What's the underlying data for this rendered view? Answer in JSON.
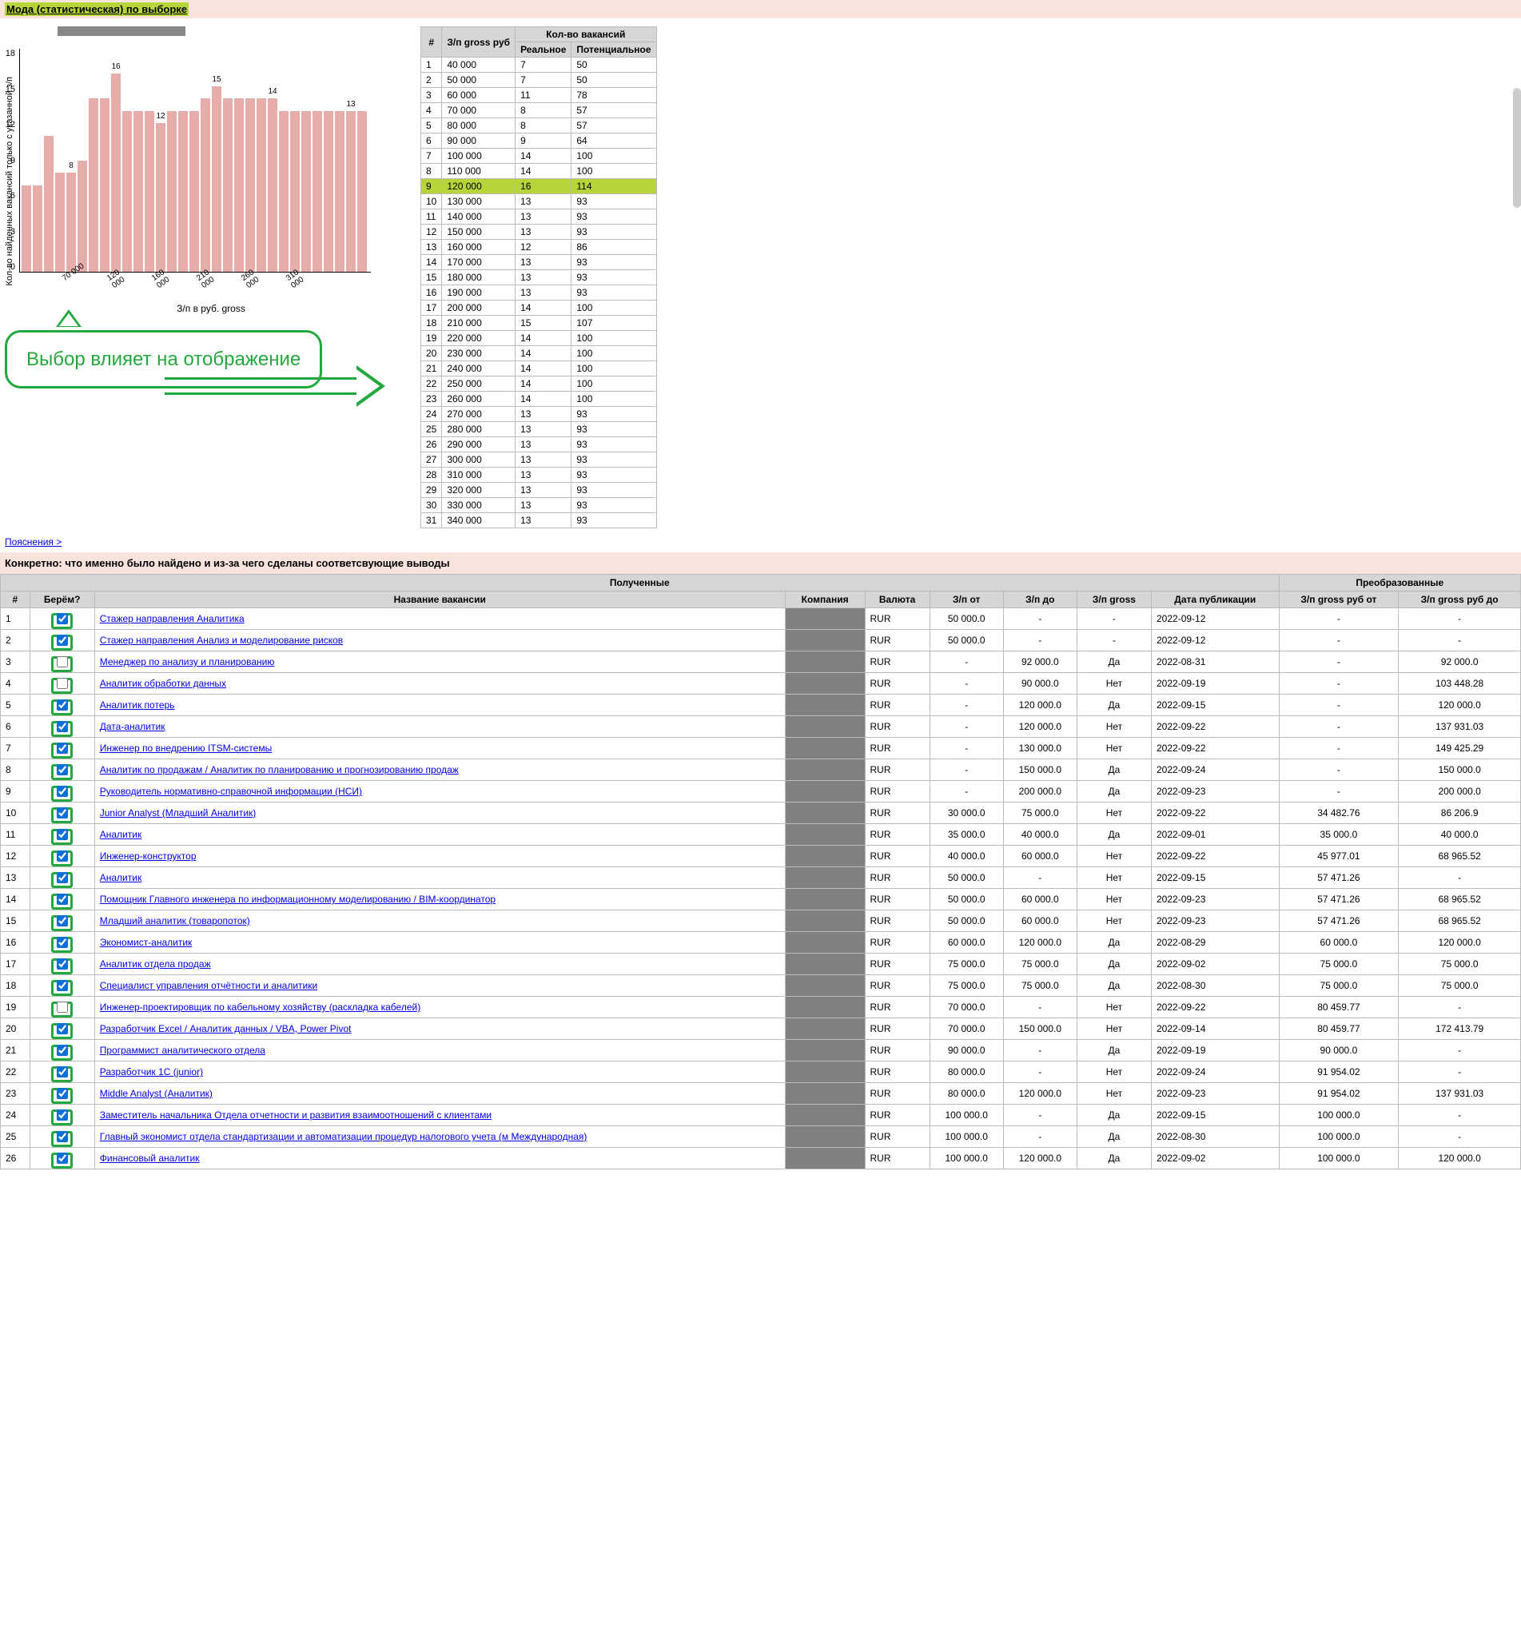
{
  "header": {
    "title": "Мода (статистическая) по выборке"
  },
  "chart_data": {
    "type": "bar",
    "xlabel": "З/п в руб. gross",
    "ylabel": "Кол-во найденных вакансий\nтолько с указанной з/п",
    "ylim": [
      0,
      18
    ],
    "yticks": [
      0,
      3,
      6,
      9,
      12,
      15,
      18
    ],
    "xticks": [
      "70 000",
      "120 000",
      "160 000",
      "210 000",
      "260 000",
      "310 000"
    ],
    "values": [
      7,
      7,
      11,
      8,
      8,
      9,
      14,
      14,
      16,
      13,
      13,
      13,
      12,
      13,
      13,
      13,
      14,
      15,
      14,
      14,
      14,
      14,
      14,
      13,
      13,
      13,
      13,
      13,
      13,
      13,
      13
    ],
    "labels": {
      "4": "8",
      "8": "16",
      "12": "12",
      "17": "15",
      "22": "14",
      "29": "13"
    }
  },
  "stat_table": {
    "group_header": "Кол-во вакансий",
    "cols": [
      "#",
      "З/п gross руб",
      "Реальное",
      "Потенциальное"
    ],
    "highlight_row": 9,
    "rows": [
      [
        1,
        "40 000",
        "7",
        "50"
      ],
      [
        2,
        "50 000",
        "7",
        "50"
      ],
      [
        3,
        "60 000",
        "11",
        "78"
      ],
      [
        4,
        "70 000",
        "8",
        "57"
      ],
      [
        5,
        "80 000",
        "8",
        "57"
      ],
      [
        6,
        "90 000",
        "9",
        "64"
      ],
      [
        7,
        "100 000",
        "14",
        "100"
      ],
      [
        8,
        "110 000",
        "14",
        "100"
      ],
      [
        9,
        "120 000",
        "16",
        "114"
      ],
      [
        10,
        "130 000",
        "13",
        "93"
      ],
      [
        11,
        "140 000",
        "13",
        "93"
      ],
      [
        12,
        "150 000",
        "13",
        "93"
      ],
      [
        13,
        "160 000",
        "12",
        "86"
      ],
      [
        14,
        "170 000",
        "13",
        "93"
      ],
      [
        15,
        "180 000",
        "13",
        "93"
      ],
      [
        16,
        "190 000",
        "13",
        "93"
      ],
      [
        17,
        "200 000",
        "14",
        "100"
      ],
      [
        18,
        "210 000",
        "15",
        "107"
      ],
      [
        19,
        "220 000",
        "14",
        "100"
      ],
      [
        20,
        "230 000",
        "14",
        "100"
      ],
      [
        21,
        "240 000",
        "14",
        "100"
      ],
      [
        22,
        "250 000",
        "14",
        "100"
      ],
      [
        23,
        "260 000",
        "14",
        "100"
      ],
      [
        24,
        "270 000",
        "13",
        "93"
      ],
      [
        25,
        "280 000",
        "13",
        "93"
      ],
      [
        26,
        "290 000",
        "13",
        "93"
      ],
      [
        27,
        "300 000",
        "13",
        "93"
      ],
      [
        28,
        "310 000",
        "13",
        "93"
      ],
      [
        29,
        "320 000",
        "13",
        "93"
      ],
      [
        30,
        "330 000",
        "13",
        "93"
      ],
      [
        31,
        "340 000",
        "13",
        "93"
      ]
    ]
  },
  "callout": "Выбор влияет на отображение",
  "explain_link": "Пояснения >",
  "subheader": "Конкретно: что именно было найдено и из-за чего сделаны соответсвующие выводы",
  "res_table": {
    "group1": "Полученные",
    "group2": "Преобразованные",
    "cols": [
      "#",
      "Берём?",
      "Название вакансии",
      "Компания",
      "Валюта",
      "З/п от",
      "З/п до",
      "З/п gross",
      "Дата публикации",
      "З/п gross руб от",
      "З/п gross руб до"
    ],
    "rows": [
      {
        "n": 1,
        "chk": true,
        "title": "Стажер направления Аналитика",
        "cur": "RUR",
        "from": "50 000.0",
        "to": "-",
        "gross": "-",
        "date": "2022-09-12",
        "gf": "-",
        "gt": "-"
      },
      {
        "n": 2,
        "chk": true,
        "title": "Стажер направления Анализ и моделирование рисков",
        "cur": "RUR",
        "from": "50 000.0",
        "to": "-",
        "gross": "-",
        "date": "2022-09-12",
        "gf": "-",
        "gt": "-"
      },
      {
        "n": 3,
        "chk": false,
        "title": "Менеджер по анализу и планированию",
        "cur": "RUR",
        "from": "-",
        "to": "92 000.0",
        "gross": "Да",
        "date": "2022-08-31",
        "gf": "-",
        "gt": "92 000.0"
      },
      {
        "n": 4,
        "chk": false,
        "title": "Аналитик обработки данных",
        "cur": "RUR",
        "from": "-",
        "to": "90 000.0",
        "gross": "Нет",
        "date": "2022-09-19",
        "gf": "-",
        "gt": "103 448.28"
      },
      {
        "n": 5,
        "chk": true,
        "title": "Аналитик потерь",
        "cur": "RUR",
        "from": "-",
        "to": "120 000.0",
        "gross": "Да",
        "date": "2022-09-15",
        "gf": "-",
        "gt": "120 000.0"
      },
      {
        "n": 6,
        "chk": true,
        "title": "Дата-аналитик",
        "cur": "RUR",
        "from": "-",
        "to": "120 000.0",
        "gross": "Нет",
        "date": "2022-09-22",
        "gf": "-",
        "gt": "137 931.03"
      },
      {
        "n": 7,
        "chk": true,
        "title": "Инженер по внедрению ITSM-системы",
        "cur": "RUR",
        "from": "-",
        "to": "130 000.0",
        "gross": "Нет",
        "date": "2022-09-22",
        "gf": "-",
        "gt": "149 425.29"
      },
      {
        "n": 8,
        "chk": true,
        "title": "Аналитик по продажам / Аналитик по планированию и прогнозированию продаж",
        "cur": "RUR",
        "from": "-",
        "to": "150 000.0",
        "gross": "Да",
        "date": "2022-09-24",
        "gf": "-",
        "gt": "150 000.0"
      },
      {
        "n": 9,
        "chk": true,
        "title": "Руководитель нормативно-справочной информации (НСИ)",
        "cur": "RUR",
        "from": "-",
        "to": "200 000.0",
        "gross": "Да",
        "date": "2022-09-23",
        "gf": "-",
        "gt": "200 000.0"
      },
      {
        "n": 10,
        "chk": true,
        "title": "Junior Analyst (Младший Аналитик)",
        "cur": "RUR",
        "from": "30 000.0",
        "to": "75 000.0",
        "gross": "Нет",
        "date": "2022-09-22",
        "gf": "34 482.76",
        "gt": "86 206.9"
      },
      {
        "n": 11,
        "chk": true,
        "title": "Аналитик",
        "cur": "RUR",
        "from": "35 000.0",
        "to": "40 000.0",
        "gross": "Да",
        "date": "2022-09-01",
        "gf": "35 000.0",
        "gt": "40 000.0"
      },
      {
        "n": 12,
        "chk": true,
        "title": "Инженер-конструктор",
        "cur": "RUR",
        "from": "40 000.0",
        "to": "60 000.0",
        "gross": "Нет",
        "date": "2022-09-22",
        "gf": "45 977.01",
        "gt": "68 965.52"
      },
      {
        "n": 13,
        "chk": true,
        "title": "Аналитик",
        "cur": "RUR",
        "from": "50 000.0",
        "to": "-",
        "gross": "Нет",
        "date": "2022-09-15",
        "gf": "57 471.26",
        "gt": "-"
      },
      {
        "n": 14,
        "chk": true,
        "title": "Помощник Главного инженера по информационному моделированию / BIM-координатор",
        "cur": "RUR",
        "from": "50 000.0",
        "to": "60 000.0",
        "gross": "Нет",
        "date": "2022-09-23",
        "gf": "57 471.26",
        "gt": "68 965.52"
      },
      {
        "n": 15,
        "chk": true,
        "title": "Младший аналитик (товаропоток)",
        "cur": "RUR",
        "from": "50 000.0",
        "to": "60 000.0",
        "gross": "Нет",
        "date": "2022-09-23",
        "gf": "57 471.26",
        "gt": "68 965.52"
      },
      {
        "n": 16,
        "chk": true,
        "title": "Экономист-аналитик",
        "cur": "RUR",
        "from": "60 000.0",
        "to": "120 000.0",
        "gross": "Да",
        "date": "2022-08-29",
        "gf": "60 000.0",
        "gt": "120 000.0"
      },
      {
        "n": 17,
        "chk": true,
        "title": "Аналитик отдела продаж",
        "cur": "RUR",
        "from": "75 000.0",
        "to": "75 000.0",
        "gross": "Да",
        "date": "2022-09-02",
        "gf": "75 000.0",
        "gt": "75 000.0"
      },
      {
        "n": 18,
        "chk": true,
        "title": "Специалист управления отчётности и аналитики",
        "cur": "RUR",
        "from": "75 000.0",
        "to": "75 000.0",
        "gross": "Да",
        "date": "2022-08-30",
        "gf": "75 000.0",
        "gt": "75 000.0"
      },
      {
        "n": 19,
        "chk": false,
        "title": "Инженер-проектировщик по кабельному хозяйству (раскладка кабелей)",
        "cur": "RUR",
        "from": "70 000.0",
        "to": "-",
        "gross": "Нет",
        "date": "2022-09-22",
        "gf": "80 459.77",
        "gt": "-"
      },
      {
        "n": 20,
        "chk": true,
        "title": "Разработчик Excel / Аналитик данных / VBA, Power Pivot",
        "cur": "RUR",
        "from": "70 000.0",
        "to": "150 000.0",
        "gross": "Нет",
        "date": "2022-09-14",
        "gf": "80 459.77",
        "gt": "172 413.79"
      },
      {
        "n": 21,
        "chk": true,
        "title": "Программист аналитического отдела",
        "cur": "RUR",
        "from": "90 000.0",
        "to": "-",
        "gross": "Да",
        "date": "2022-09-19",
        "gf": "90 000.0",
        "gt": "-"
      },
      {
        "n": 22,
        "chk": true,
        "title": "Разработчик 1С (junior)",
        "cur": "RUR",
        "from": "80 000.0",
        "to": "-",
        "gross": "Нет",
        "date": "2022-09-24",
        "gf": "91 954.02",
        "gt": "-"
      },
      {
        "n": 23,
        "chk": true,
        "title": "Middle Analyst (Аналитик)",
        "cur": "RUR",
        "from": "80 000.0",
        "to": "120 000.0",
        "gross": "Нет",
        "date": "2022-09-23",
        "gf": "91 954.02",
        "gt": "137 931.03"
      },
      {
        "n": 24,
        "chk": true,
        "title": "Заместитель начальника Отдела отчетности и развития взаимоотношений с клиентами",
        "cur": "RUR",
        "from": "100 000.0",
        "to": "-",
        "gross": "Да",
        "date": "2022-09-15",
        "gf": "100 000.0",
        "gt": "-"
      },
      {
        "n": 25,
        "chk": true,
        "title": "Главный экономист отдела стандартизации и автоматизации процедур налогового учета (м Международная)",
        "cur": "RUR",
        "from": "100 000.0",
        "to": "-",
        "gross": "Да",
        "date": "2022-08-30",
        "gf": "100 000.0",
        "gt": "-"
      },
      {
        "n": 26,
        "chk": true,
        "title": "Финансовый аналитик",
        "cur": "RUR",
        "from": "100 000.0",
        "to": "120 000.0",
        "gross": "Да",
        "date": "2022-09-02",
        "gf": "100 000.0",
        "gt": "120 000.0"
      }
    ]
  }
}
